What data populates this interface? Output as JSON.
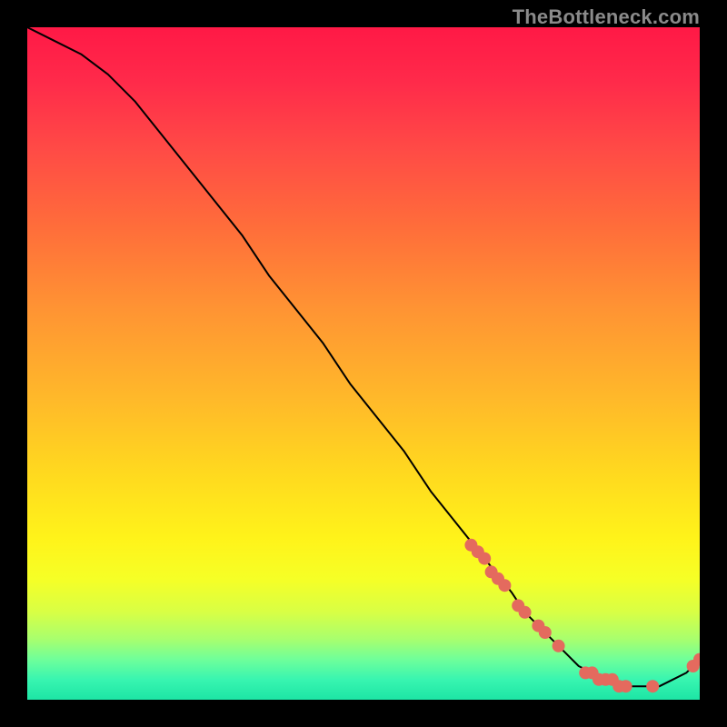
{
  "watermark": "TheBottleneck.com",
  "chart_data": {
    "type": "line",
    "title": "",
    "xlabel": "",
    "ylabel": "",
    "xlim": [
      0,
      100
    ],
    "ylim": [
      0,
      100
    ],
    "grid": false,
    "legend": false,
    "series": [
      {
        "name": "bottleneck-curve",
        "x": [
          0,
          4,
          8,
          12,
          16,
          20,
          24,
          28,
          32,
          36,
          40,
          44,
          48,
          52,
          56,
          60,
          64,
          68,
          72,
          74,
          76,
          78,
          80,
          82,
          84,
          86,
          88,
          90,
          92,
          94,
          96,
          98,
          100
        ],
        "y": [
          100,
          98,
          96,
          93,
          89,
          84,
          79,
          74,
          69,
          63,
          58,
          53,
          47,
          42,
          37,
          31,
          26,
          21,
          16,
          13,
          11,
          9,
          7,
          5,
          4,
          3,
          2,
          2,
          2,
          2,
          3,
          4,
          6
        ]
      }
    ],
    "markers": {
      "name": "highlighted-points",
      "color": "#e46a5e",
      "points": [
        {
          "x": 66,
          "y": 23
        },
        {
          "x": 67,
          "y": 22
        },
        {
          "x": 68,
          "y": 21
        },
        {
          "x": 69,
          "y": 19
        },
        {
          "x": 70,
          "y": 18
        },
        {
          "x": 71,
          "y": 17
        },
        {
          "x": 73,
          "y": 14
        },
        {
          "x": 74,
          "y": 13
        },
        {
          "x": 76,
          "y": 11
        },
        {
          "x": 77,
          "y": 10
        },
        {
          "x": 79,
          "y": 8
        },
        {
          "x": 83,
          "y": 4
        },
        {
          "x": 84,
          "y": 4
        },
        {
          "x": 85,
          "y": 3
        },
        {
          "x": 86,
          "y": 3
        },
        {
          "x": 87,
          "y": 3
        },
        {
          "x": 88,
          "y": 2
        },
        {
          "x": 89,
          "y": 2
        },
        {
          "x": 93,
          "y": 2
        },
        {
          "x": 99,
          "y": 5
        },
        {
          "x": 100,
          "y": 6
        }
      ]
    }
  }
}
